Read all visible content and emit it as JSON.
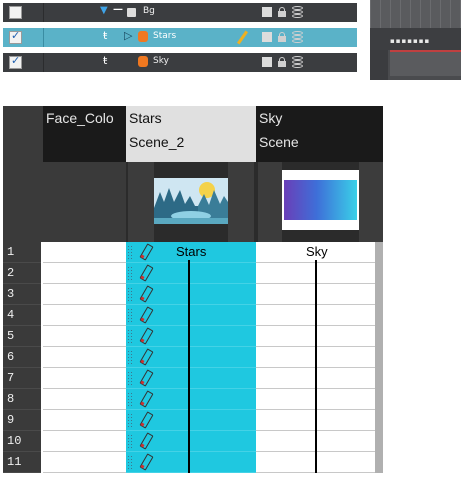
{
  "timeline": {
    "layers": [
      {
        "name": "Bg",
        "checked": false,
        "selected": false,
        "type": "group"
      },
      {
        "name": "Stars",
        "checked": true,
        "selected": true,
        "type": "drawing"
      },
      {
        "name": "Sky",
        "checked": true,
        "selected": false,
        "type": "drawing"
      }
    ]
  },
  "xsheet": {
    "columns": [
      {
        "name": "Face_Colo",
        "sub": ""
      },
      {
        "name": "Stars",
        "sub": "Scene_2"
      },
      {
        "name": "Sky",
        "sub": "Scene"
      }
    ],
    "frame_numbers": [
      "1",
      "2",
      "3",
      "4",
      "5",
      "6",
      "7",
      "8",
      "9",
      "10",
      "11"
    ],
    "stars_cell_label": "Stars",
    "sky_cell_label": "Sky"
  },
  "colors": {
    "selected_layer": "#5ab2c8",
    "xsheet_selection": "#1fc8e0",
    "panel_dark": "#3b3d40"
  }
}
